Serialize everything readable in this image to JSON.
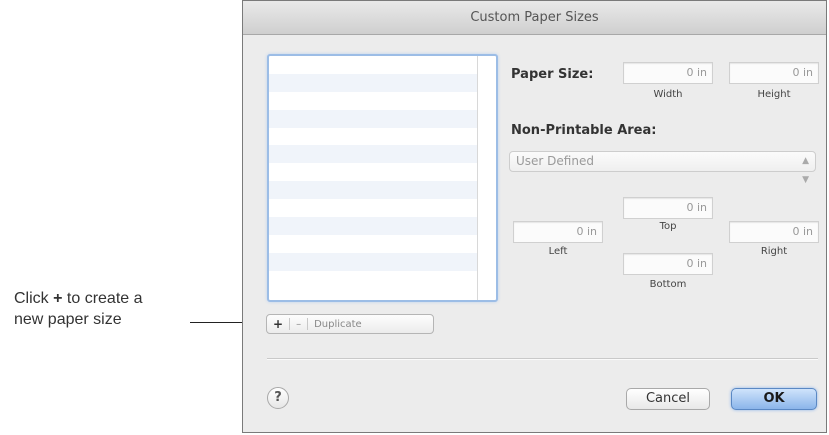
{
  "callout": {
    "line1_pre": "Click ",
    "line1_plus": "+",
    "line1_post": " to create a",
    "line2": "new paper size"
  },
  "dialog": {
    "title": "Custom Paper Sizes",
    "paper_size_label": "Paper Size:",
    "width_value": "0 in",
    "width_label": "Width",
    "height_value": "0 in",
    "height_label": "Height",
    "non_printable_label": "Non-Printable Area:",
    "non_printable_select": "User Defined",
    "top_value": "0 in",
    "top_label": "Top",
    "left_value": "0 in",
    "left_label": "Left",
    "right_value": "0 in",
    "right_label": "Right",
    "bottom_value": "0 in",
    "bottom_label": "Bottom",
    "list_buttons": {
      "add": "+",
      "remove": "–",
      "duplicate": "Duplicate"
    },
    "help_label": "?",
    "cancel_label": "Cancel",
    "ok_label": "OK"
  }
}
